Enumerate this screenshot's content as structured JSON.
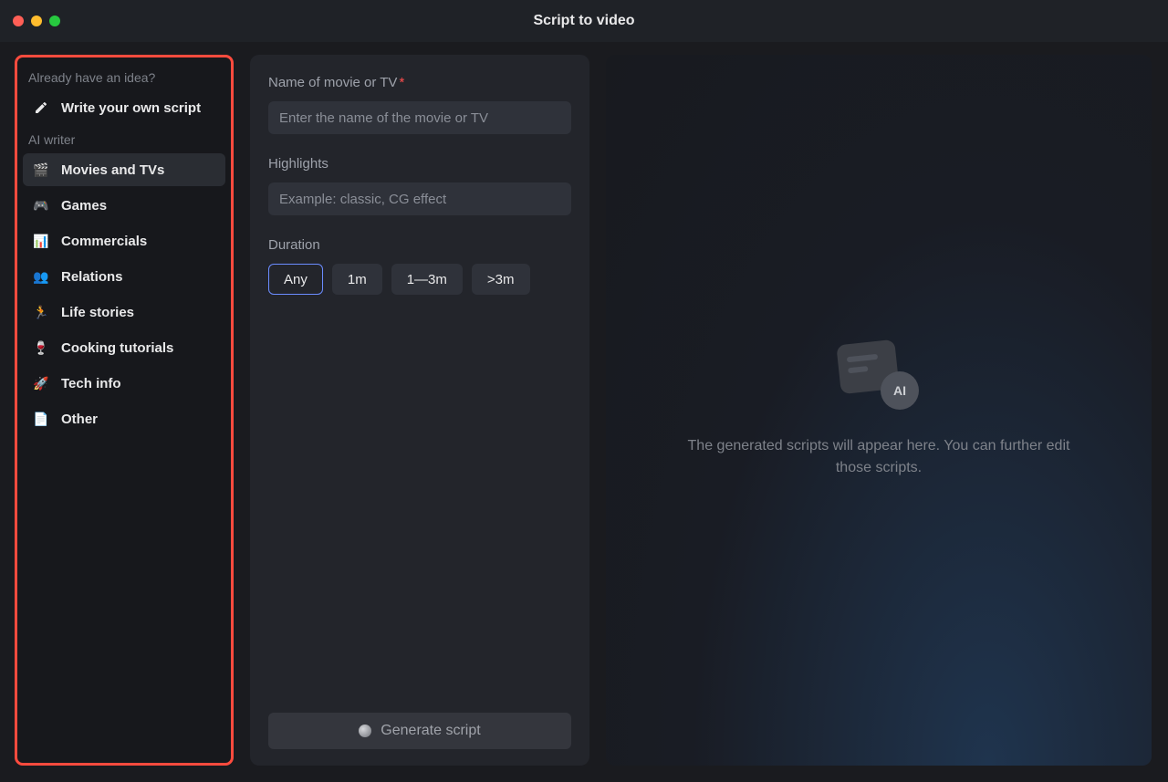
{
  "window": {
    "title": "Script to video"
  },
  "sidebar": {
    "idea_header": "Already have an idea?",
    "write_own": "Write your own script",
    "ai_header": "AI writer",
    "items": [
      {
        "label": "Movies and TVs",
        "icon": "🎬",
        "name": "movies-and-tvs"
      },
      {
        "label": "Games",
        "icon": "🎮",
        "name": "games"
      },
      {
        "label": "Commercials",
        "icon": "📊",
        "name": "commercials"
      },
      {
        "label": "Relations",
        "icon": "👥",
        "name": "relations"
      },
      {
        "label": "Life stories",
        "icon": "🏃",
        "name": "life-stories"
      },
      {
        "label": "Cooking tutorials",
        "icon": "🍷",
        "name": "cooking-tutorials"
      },
      {
        "label": "Tech info",
        "icon": "🚀",
        "name": "tech-info"
      },
      {
        "label": "Other",
        "icon": "📄",
        "name": "other"
      }
    ],
    "active_index": 0
  },
  "form": {
    "name_label": "Name of movie or TV",
    "name_placeholder": "Enter the name of the movie or TV",
    "highlights_label": "Highlights",
    "highlights_placeholder": "Example: classic, CG effect",
    "duration_label": "Duration",
    "durations": [
      "Any",
      "1m",
      "1—3m",
      ">3m"
    ],
    "duration_selected_index": 0,
    "generate_label": "Generate script"
  },
  "preview": {
    "ai_badge": "AI",
    "placeholder": "The generated scripts will appear here. You can further edit those scripts."
  }
}
